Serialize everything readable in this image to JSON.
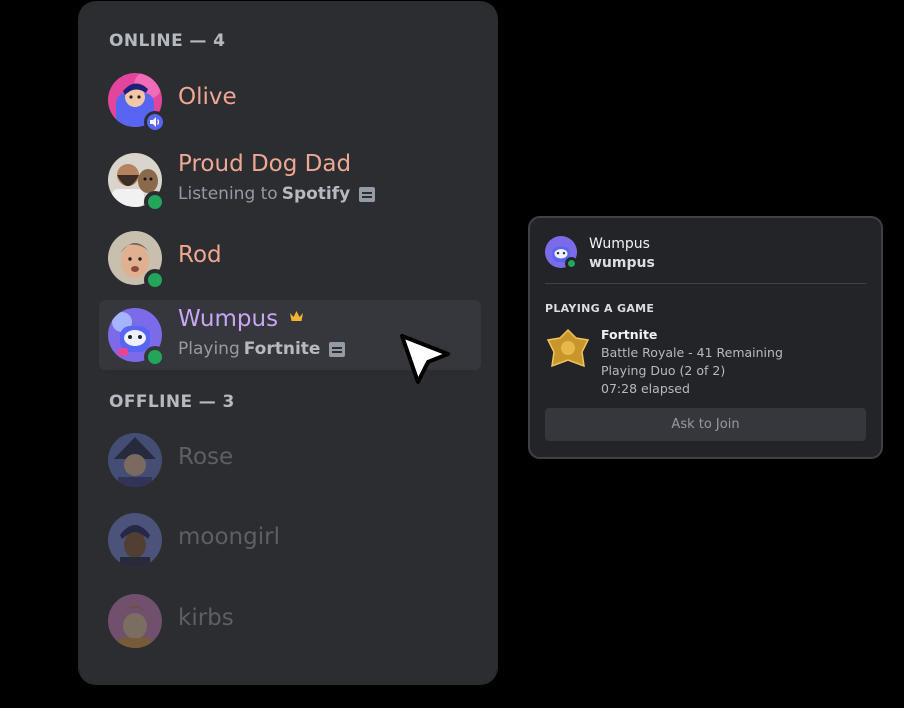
{
  "members_panel": {
    "online_header": "ONLINE — 4",
    "offline_header": "OFFLINE — 3",
    "online": [
      {
        "name": "Olive",
        "name_color": "#f0a791",
        "status": "voice",
        "activity_prefix": "",
        "activity_app": ""
      },
      {
        "name": "Proud Dog Dad",
        "name_color": "#f0a791",
        "status": "online",
        "activity_prefix": "Listening to",
        "activity_app": "Spotify"
      },
      {
        "name": "Rod",
        "name_color": "#f0a791",
        "status": "online",
        "activity_prefix": "",
        "activity_app": ""
      },
      {
        "name": "Wumpus",
        "name_color": "#c8a6f5",
        "status": "online",
        "activity_prefix": "Playing",
        "activity_app": "Fortnite",
        "crown": "crown-icon"
      }
    ],
    "offline": [
      {
        "name": "Rose",
        "name_color": "#5c5f66"
      },
      {
        "name": "moongirl",
        "name_color": "#5c5f66"
      },
      {
        "name": "kirbs",
        "name_color": "#5c5f66"
      }
    ]
  },
  "profile_popout": {
    "display_name": "Wumpus",
    "username": "wumpus",
    "section_title": "PLAYING A GAME",
    "game": {
      "title": "Fortnite",
      "details": "Battle Royale - 41 Remaining",
      "state": "Playing Duo (2 of 2)",
      "elapsed": "07:28 elapsed"
    },
    "join_button": "Ask to Join"
  },
  "colors": {
    "panel_bg": "#2b2d31",
    "online_green": "#23a55a",
    "blurple": "#5865f2"
  },
  "icons": [
    "speaker-icon",
    "rich-presence-icon",
    "crown-icon",
    "cursor-icon",
    "fortnite-badge-icon"
  ]
}
